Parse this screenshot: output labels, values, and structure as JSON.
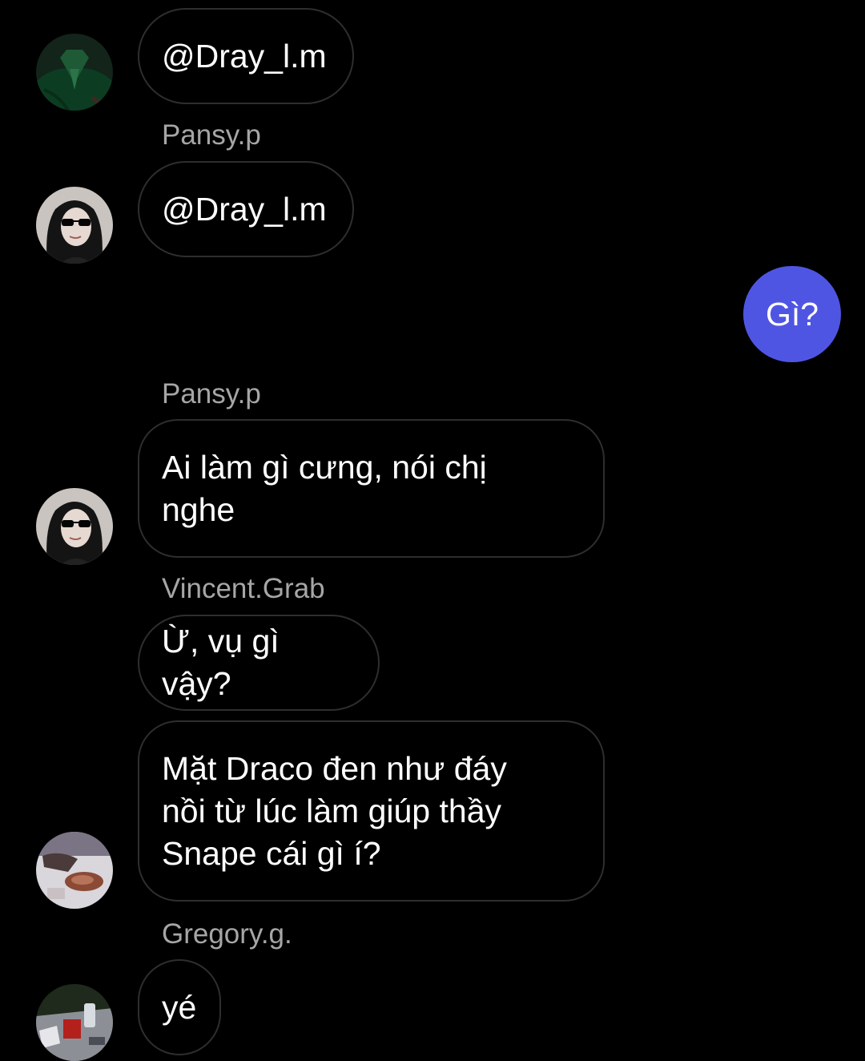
{
  "conversation": {
    "messages": [
      {
        "sender": "",
        "text": "@Dray_l.m",
        "avatar": "green-uniform-avatar"
      },
      {
        "sender": "Pansy.p",
        "text": "@Dray_l.m",
        "avatar": "sunglasses-girl-avatar"
      },
      {
        "sender": "",
        "text": "Gì?",
        "outgoing": true,
        "color": "#4f55e3"
      },
      {
        "sender": "Pansy.p",
        "text": "Ai làm gì cưng, nói chị nghe",
        "avatar": "sunglasses-girl-avatar"
      },
      {
        "sender": "Vincent.Grab",
        "text": "Ừ, vụ gì vậy?"
      },
      {
        "sender": "",
        "text": "Mặt Draco đen như đáy nồi từ lúc làm giúp thầy Snape cái gì í?",
        "avatar": "food-photo-avatar"
      },
      {
        "sender": "Gregory.g.",
        "text": "yé",
        "avatar": "table-photo-avatar"
      }
    ]
  },
  "colors": {
    "background": "#000000",
    "bubble_border": "#2e2e2e",
    "sender_text": "#a6a6a6",
    "outgoing_bubble": "#4f55e3"
  }
}
